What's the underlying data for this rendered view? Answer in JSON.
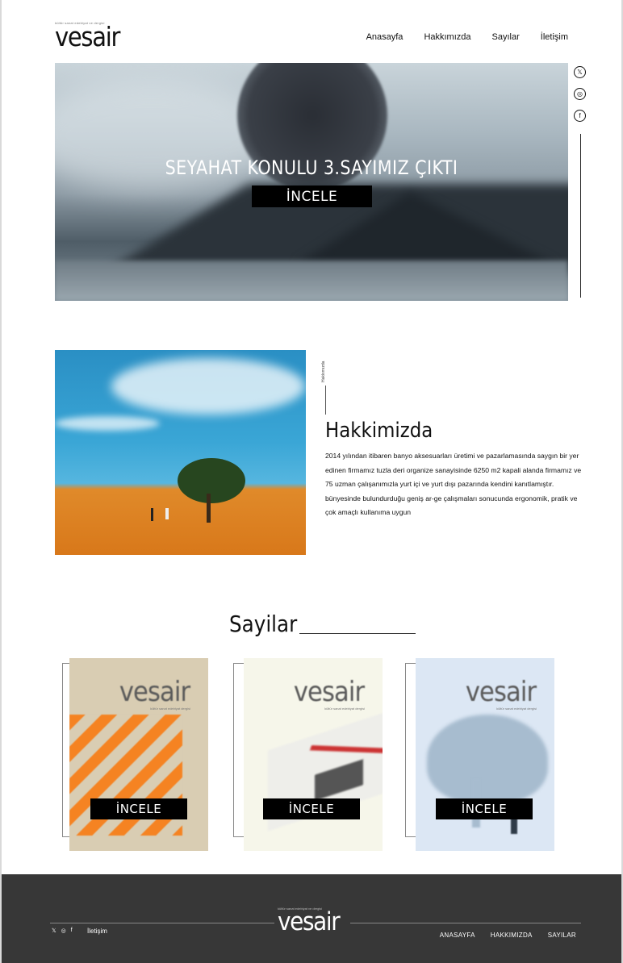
{
  "brand": {
    "tagline": "kültür sanat edebiyat ve dergisi",
    "name": "vesair"
  },
  "nav": [
    "Anasayfa",
    "Hakkımızda",
    "Sayılar",
    "İletişim"
  ],
  "hero": {
    "title": "SEYAHAT KONULU 3.SAYIMIZ ÇIKTI",
    "button": "İNCELE"
  },
  "social": {
    "icons": [
      "twitter-icon",
      "instagram-icon",
      "facebook-icon"
    ],
    "glyphs": [
      "𝕏",
      "◎",
      "f"
    ]
  },
  "about": {
    "side_label": "Hakkımızda",
    "heading": "Hakkimizda",
    "text": "2014 yılından itibaren banyo aksesuarları üretimi ve pazarlamasında saygın bir yer edinen firmamız tuzla deri organize sanayisinde 6250 m2 kapali alanda firmamız ve 75 uzman çalışanımızla yurt içi ve yurt dışı pazarında kendini kanıtlamıştır. bünyesinde bulundurduğu geniş ar-ge çalışmaları sonucunda ergonomik, pratik ve çok amaçlı kullanıma uygun"
  },
  "issues": {
    "heading": "Sayilar",
    "cards": [
      {
        "cover_title": "vesair",
        "cover_sub": "kültür sanat edebiyat dergisi",
        "button": "İNCELE"
      },
      {
        "cover_title": "vesair",
        "cover_sub": "kültür sanat edebiyat dergisi",
        "button": "İNCELE"
      },
      {
        "cover_title": "vesair",
        "cover_sub": "kültür sanat edebiyat dergisi",
        "button": "İNCELE"
      }
    ]
  },
  "footer": {
    "tagline": "kültür sanat edebiyat ve dergisi",
    "name": "vesair",
    "contact": "İletişim",
    "nav": [
      "ANASAYFA",
      "HAKKIMIZDA",
      "SAYILAR"
    ],
    "social_glyphs": [
      "𝕏",
      "◎",
      "f"
    ]
  },
  "colors": {
    "footer_bg": "#373737",
    "button_bg": "#000000",
    "accent_orange": "#f58322"
  }
}
